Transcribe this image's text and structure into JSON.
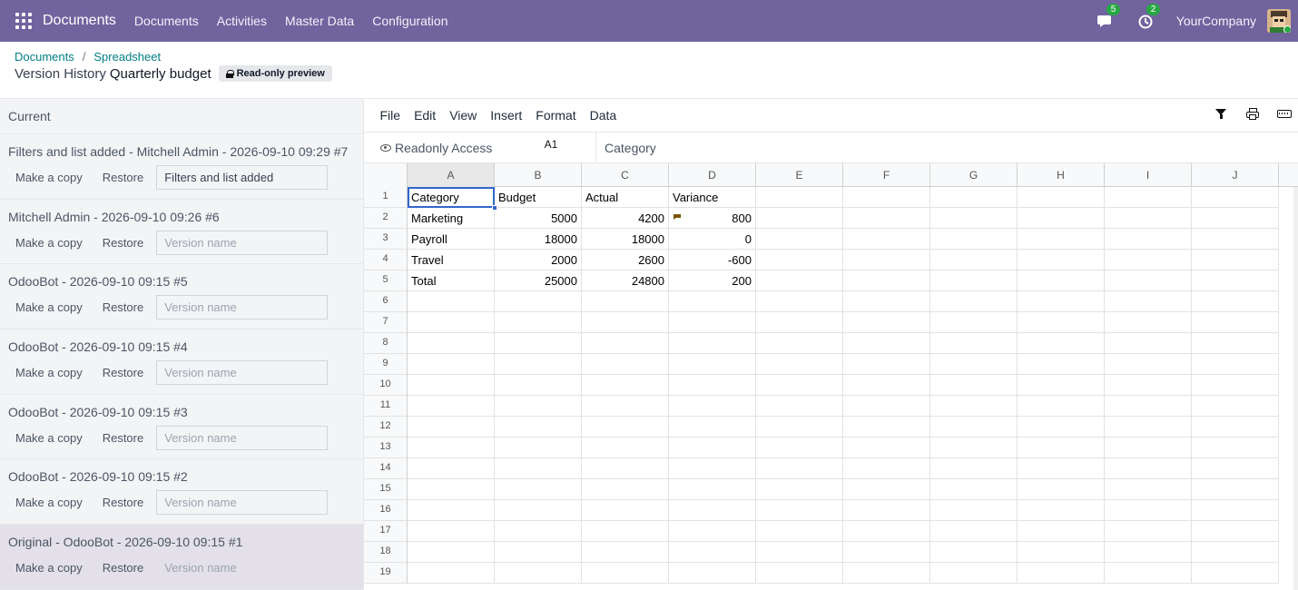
{
  "navbar": {
    "app_name": "Documents",
    "menu": [
      "Documents",
      "Activities",
      "Master Data",
      "Configuration"
    ],
    "messages_count": "5",
    "activities_count": "2",
    "company": "YourCompany"
  },
  "breadcrumb": {
    "items": [
      "Documents",
      "Spreadsheet"
    ]
  },
  "title": {
    "prefix": "Version History",
    "name": "Quarterly budget",
    "badge": "Read-only preview"
  },
  "versions": {
    "current_label": "Current",
    "make_copy_label": "Make a copy",
    "restore_label": "Restore",
    "placeholder": "Version name",
    "items": [
      {
        "title": "Filters and list added - Mitchell Admin - 2026-09-10 09:29 #7",
        "name": "Filters and list added"
      },
      {
        "title": "Mitchell Admin - 2026-09-10 09:26 #6",
        "name": ""
      },
      {
        "title": "OdooBot - 2026-09-10 09:15 #5",
        "name": ""
      },
      {
        "title": "OdooBot - 2026-09-10 09:15 #4",
        "name": ""
      },
      {
        "title": "OdooBot - 2026-09-10 09:15 #3",
        "name": ""
      },
      {
        "title": "OdooBot - 2026-09-10 09:15 #2",
        "name": ""
      },
      {
        "title": "Original - OdooBot - 2026-09-10 09:15 #1",
        "name": ""
      }
    ]
  },
  "sheet": {
    "menu": [
      "File",
      "Edit",
      "View",
      "Insert",
      "Format",
      "Data"
    ],
    "readonly_label": "Readonly Access",
    "cell_ref": "A1",
    "formula_value": "Category",
    "columns": [
      "A",
      "B",
      "C",
      "D",
      "E",
      "F",
      "G",
      "H",
      "I",
      "J"
    ],
    "row_numbers": [
      "1",
      "2",
      "3",
      "4",
      "5",
      "6",
      "7",
      "8",
      "9",
      "10",
      "11",
      "12",
      "13",
      "14",
      "15",
      "16",
      "17",
      "18",
      "19"
    ],
    "rows": [
      [
        "Category",
        "Budget",
        "Actual",
        "Variance"
      ],
      [
        "Marketing",
        "5000",
        "4200",
        "800"
      ],
      [
        "Payroll",
        "18000",
        "18000",
        "0"
      ],
      [
        "Travel",
        "2000",
        "2600",
        "-600"
      ],
      [
        "Total",
        "25000",
        "24800",
        "200"
      ]
    ]
  }
}
